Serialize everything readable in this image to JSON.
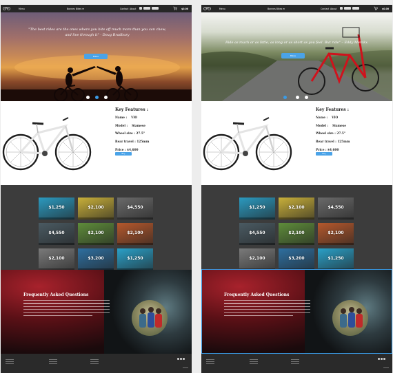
{
  "nav": {
    "menu_label": "Menu",
    "brand": "Bonnes Bikes ✉",
    "contact": "Contact",
    "about": "About",
    "total": "$0.00"
  },
  "left": {
    "hero_quote": "\"The best rides are the ones where you bite off much more than you can chew, and live through it\" - Doug Bradbury",
    "hero_button": "Bikes",
    "active_dot": 1
  },
  "right": {
    "hero_quote": "Ride as much or as little, as long or as short as you feel. But ride\" – Eddy Merckx",
    "hero_button": "Bikes",
    "active_dot": 0
  },
  "product": {
    "heading": "Key Features :",
    "name_label": "Name :",
    "name_value": "VIO",
    "model_label": "Model :",
    "model_value": "Siamese",
    "wheel_label": "Wheel size : 27.5\"",
    "travel_label": "Rear travel : 125mm",
    "price_label": "Price : $4,600",
    "buy_label": "Buy"
  },
  "gallery": {
    "tiles": [
      {
        "price": "$1,250",
        "color": "#2b9ac0"
      },
      {
        "price": "$2,100",
        "color": "#c9b03a"
      },
      {
        "price": "$4,550",
        "color": "#6a6a6a"
      },
      {
        "price": "$4,550",
        "color": "#4a5a62"
      },
      {
        "price": "$2,100",
        "color": "#5e8c3a"
      },
      {
        "price": "$2,100",
        "color": "#b5582c"
      },
      {
        "price": "$2,100",
        "color": "#7a7a7a"
      },
      {
        "price": "$3,200",
        "color": "#2e6fa0"
      },
      {
        "price": "$1,250",
        "color": "#2aa0c8"
      }
    ]
  },
  "faq": {
    "heading": "Frequently Asked Questions"
  },
  "colors": {
    "accent": "#3a9be6",
    "nav_bg": "#262626",
    "gallery_bg": "#3c3c3c",
    "footer_bg": "#2a2a2a"
  }
}
